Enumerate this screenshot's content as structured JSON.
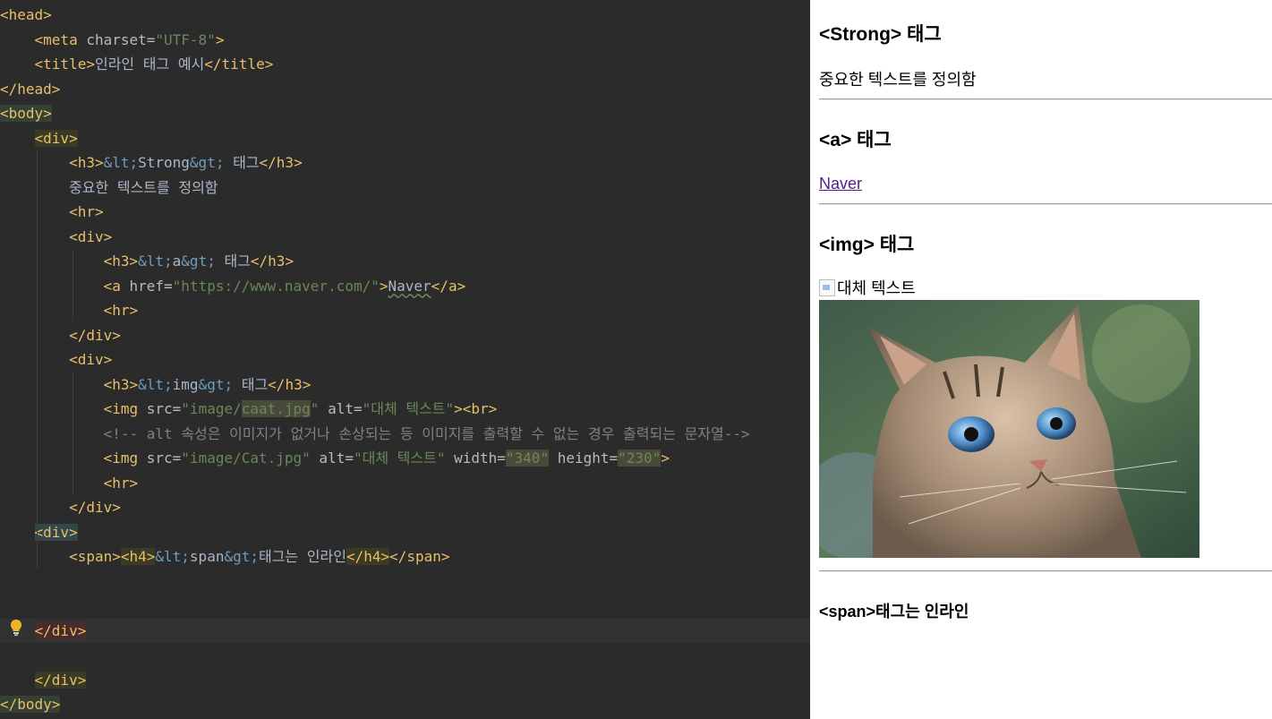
{
  "editor": {
    "lines": [
      {
        "segs": [
          {
            "t": "<head>",
            "c": "tag"
          }
        ]
      },
      {
        "segs": [
          {
            "t": "    "
          },
          {
            "t": "<meta ",
            "c": "tag"
          },
          {
            "t": "charset=",
            "c": "attr"
          },
          {
            "t": "\"UTF-8\"",
            "c": "val"
          },
          {
            "t": ">",
            "c": "tag"
          }
        ]
      },
      {
        "segs": [
          {
            "t": "    "
          },
          {
            "t": "<title>",
            "c": "tag"
          },
          {
            "t": "인라인 태그 예시",
            "c": "text"
          },
          {
            "t": "</title>",
            "c": "tag"
          }
        ]
      },
      {
        "segs": [
          {
            "t": "</head>",
            "c": "tag"
          }
        ]
      },
      {
        "segs": [
          {
            "t": "<body>",
            "c": "tag",
            "h": "green"
          }
        ]
      },
      {
        "segs": [
          {
            "t": "    "
          },
          {
            "t": "<div>",
            "c": "tag",
            "h": "olive"
          }
        ]
      },
      {
        "segs": [
          {
            "t": "        "
          },
          {
            "t": "<h3>",
            "c": "tag"
          },
          {
            "t": "&lt;",
            "c": "ent"
          },
          {
            "t": "Strong",
            "c": "text"
          },
          {
            "t": "&gt;",
            "c": "ent"
          },
          {
            "t": " 태그",
            "c": "text"
          },
          {
            "t": "</h3>",
            "c": "tag"
          }
        ]
      },
      {
        "segs": [
          {
            "t": "        "
          },
          {
            "t": "중요한 텍스트를 정의함",
            "c": "text"
          }
        ]
      },
      {
        "segs": [
          {
            "t": "        "
          },
          {
            "t": "<hr>",
            "c": "tag"
          }
        ]
      },
      {
        "segs": [
          {
            "t": "        "
          },
          {
            "t": "<div>",
            "c": "tag"
          }
        ]
      },
      {
        "segs": [
          {
            "t": "            "
          },
          {
            "t": "<h3>",
            "c": "tag"
          },
          {
            "t": "&lt;",
            "c": "ent"
          },
          {
            "t": "a",
            "c": "text"
          },
          {
            "t": "&gt;",
            "c": "ent"
          },
          {
            "t": " 태그",
            "c": "text"
          },
          {
            "t": "</h3>",
            "c": "tag"
          }
        ]
      },
      {
        "segs": [
          {
            "t": "            "
          },
          {
            "t": "<a ",
            "c": "tag"
          },
          {
            "t": "href=",
            "c": "attr"
          },
          {
            "t": "\"https://www.naver.com/\"",
            "c": "val"
          },
          {
            "t": ">",
            "c": "tag"
          },
          {
            "t": "Naver",
            "c": "text",
            "sq": true
          },
          {
            "t": "</a>",
            "c": "tag"
          }
        ]
      },
      {
        "segs": [
          {
            "t": "            "
          },
          {
            "t": "<hr>",
            "c": "tag"
          }
        ]
      },
      {
        "segs": [
          {
            "t": "        "
          },
          {
            "t": "</div>",
            "c": "tag"
          }
        ]
      },
      {
        "segs": [
          {
            "t": "        "
          },
          {
            "t": "<div>",
            "c": "tag"
          }
        ]
      },
      {
        "segs": [
          {
            "t": "            "
          },
          {
            "t": "<h3>",
            "c": "tag"
          },
          {
            "t": "&lt;",
            "c": "ent"
          },
          {
            "t": "img",
            "c": "text"
          },
          {
            "t": "&gt;",
            "c": "ent"
          },
          {
            "t": " 태그",
            "c": "text"
          },
          {
            "t": "</h3>",
            "c": "tag"
          }
        ]
      },
      {
        "segs": [
          {
            "t": "            "
          },
          {
            "t": "<img ",
            "c": "tag"
          },
          {
            "t": "src=",
            "c": "attr"
          },
          {
            "t": "\"image/",
            "c": "val"
          },
          {
            "t": "caat.jpg",
            "c": "val",
            "h": "dim"
          },
          {
            "t": "\"",
            "c": "val"
          },
          {
            "t": " alt=",
            "c": "attr"
          },
          {
            "t": "\"대체 텍스트\"",
            "c": "val"
          },
          {
            "t": "><br>",
            "c": "tag"
          }
        ]
      },
      {
        "segs": [
          {
            "t": "            "
          },
          {
            "t": "<!-- alt 속성은 이미지가 없거나 손상되는 등 이미지를 출력할 수 없는 경우 출력되는 문자열-->",
            "c": "cmt"
          }
        ]
      },
      {
        "segs": [
          {
            "t": "            "
          },
          {
            "t": "<img ",
            "c": "tag"
          },
          {
            "t": "src=",
            "c": "attr"
          },
          {
            "t": "\"image/Cat.jpg\"",
            "c": "val"
          },
          {
            "t": " alt=",
            "c": "attr"
          },
          {
            "t": "\"대체 텍스트\"",
            "c": "val"
          },
          {
            "t": " width=",
            "c": "attr"
          },
          {
            "t": "\"340\"",
            "c": "val",
            "h": "dim"
          },
          {
            "t": " height=",
            "c": "attr"
          },
          {
            "t": "\"230\"",
            "c": "val",
            "h": "dim"
          },
          {
            "t": ">",
            "c": "tag"
          }
        ]
      },
      {
        "segs": [
          {
            "t": "            "
          },
          {
            "t": "<hr>",
            "c": "tag"
          }
        ]
      },
      {
        "segs": [
          {
            "t": "        "
          },
          {
            "t": "</div>",
            "c": "tag"
          }
        ]
      },
      {
        "segs": [
          {
            "t": "    "
          },
          {
            "t": "<div>",
            "c": "tag",
            "h": "teal"
          }
        ]
      },
      {
        "segs": [
          {
            "t": "        "
          },
          {
            "t": "<span>",
            "c": "tag"
          },
          {
            "t": "<h4>",
            "c": "tag",
            "h": "olive"
          },
          {
            "t": "&lt;",
            "c": "ent"
          },
          {
            "t": "span",
            "c": "text"
          },
          {
            "t": "&gt;",
            "c": "ent"
          },
          {
            "t": "태그는 인라인",
            "c": "text"
          },
          {
            "t": "</h4>",
            "c": "tag",
            "h": "olive"
          },
          {
            "t": "</span>",
            "c": "tag"
          }
        ]
      },
      {
        "segs": []
      },
      {
        "segs": []
      },
      {
        "segs": [
          {
            "t": "    "
          },
          {
            "t": "</div>",
            "c": "tag",
            "h": "red"
          }
        ],
        "active": true
      },
      {
        "segs": []
      },
      {
        "segs": [
          {
            "t": "    "
          },
          {
            "t": "</div>",
            "c": "tag",
            "h": "olive"
          }
        ]
      },
      {
        "segs": [
          {
            "t": "</body>",
            "c": "tag",
            "h": "green"
          }
        ]
      }
    ]
  },
  "preview": {
    "h3_strong": "<Strong> 태그",
    "strong_text": "중요한 텍스트를 정의함",
    "h3_a": "<a> 태그",
    "link_label": "Naver",
    "h3_img": "<img> 태그",
    "alt_text": "대체 텍스트",
    "h4_span": "<span>태그는 인라인"
  }
}
